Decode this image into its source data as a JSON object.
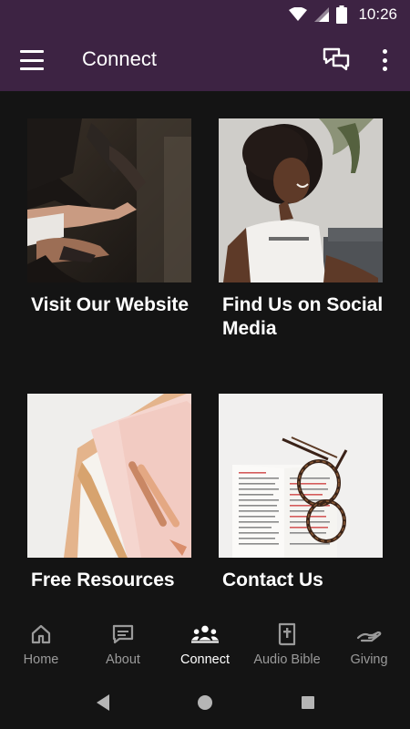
{
  "status_bar": {
    "time": "10:26"
  },
  "app_bar": {
    "title": "Connect"
  },
  "cards": [
    {
      "label": "Visit Our Website"
    },
    {
      "label": "Find Us on Social Media"
    },
    {
      "label": "Free Resources"
    },
    {
      "label": "Contact Us"
    }
  ],
  "bottom_nav": {
    "items": [
      {
        "label": "Home",
        "icon": "home-icon"
      },
      {
        "label": "About",
        "icon": "about-icon"
      },
      {
        "label": "Connect",
        "icon": "people-icon",
        "active": true
      },
      {
        "label": "Audio Bible",
        "icon": "bible-icon"
      },
      {
        "label": "Giving",
        "icon": "giving-icon"
      }
    ]
  },
  "colors": {
    "app_bar": "#3d2343",
    "background": "#141414",
    "nav_inactive": "#9a9a9a",
    "nav_active": "#ffffff"
  }
}
